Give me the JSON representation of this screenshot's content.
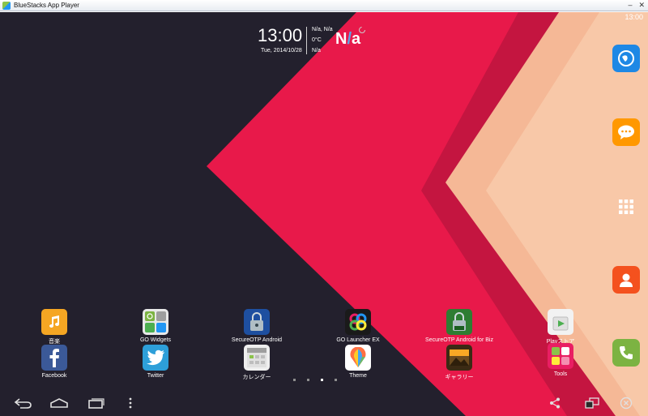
{
  "window": {
    "title": "BlueStacks App Player"
  },
  "status": {
    "time": "13:00"
  },
  "clock": {
    "time": "13:00",
    "date": "Tue, 2014/10/28",
    "location": "N/a, N/a",
    "temperature": "0°C",
    "condition": "N/a",
    "big_prefix": "N",
    "big_slash": "/",
    "big_suffix": "a"
  },
  "apps_row1": [
    {
      "label": "音楽",
      "icon": "music-icon"
    },
    {
      "label": "GO Widgets",
      "icon": "go-widgets-icon"
    },
    {
      "label": "SecureOTP Android",
      "icon": "lock-icon"
    },
    {
      "label": "GO Launcher EX",
      "icon": "go-launcher-icon"
    },
    {
      "label": "SecureOTP Android for Biz",
      "icon": "lock-biz-icon"
    },
    {
      "label": "Playストア",
      "icon": "play-store-icon"
    }
  ],
  "apps_row2": [
    {
      "label": "Facebook",
      "icon": "facebook-icon"
    },
    {
      "label": "Twitter",
      "icon": "twitter-icon"
    },
    {
      "label": "カレンダー",
      "icon": "calendar-icon"
    },
    {
      "label": "Theme",
      "icon": "theme-icon"
    },
    {
      "label": "ギャラリー",
      "icon": "gallery-icon"
    },
    {
      "label": "Tools",
      "icon": "tools-folder-icon"
    }
  ],
  "dock": [
    "browser-icon",
    "messages-icon",
    "app-drawer-icon",
    "contacts-icon",
    "phone-icon"
  ],
  "pager": {
    "count": 4,
    "active_index": 2
  },
  "nav": [
    "back-icon",
    "home-icon",
    "recent-apps-icon",
    "menu-icon",
    "share-icon",
    "screen-rotate-icon",
    "close-icon"
  ],
  "colors": {
    "accent_red": "#e8194a",
    "peach": "#f5b896",
    "dark_bg": "#23202d"
  }
}
